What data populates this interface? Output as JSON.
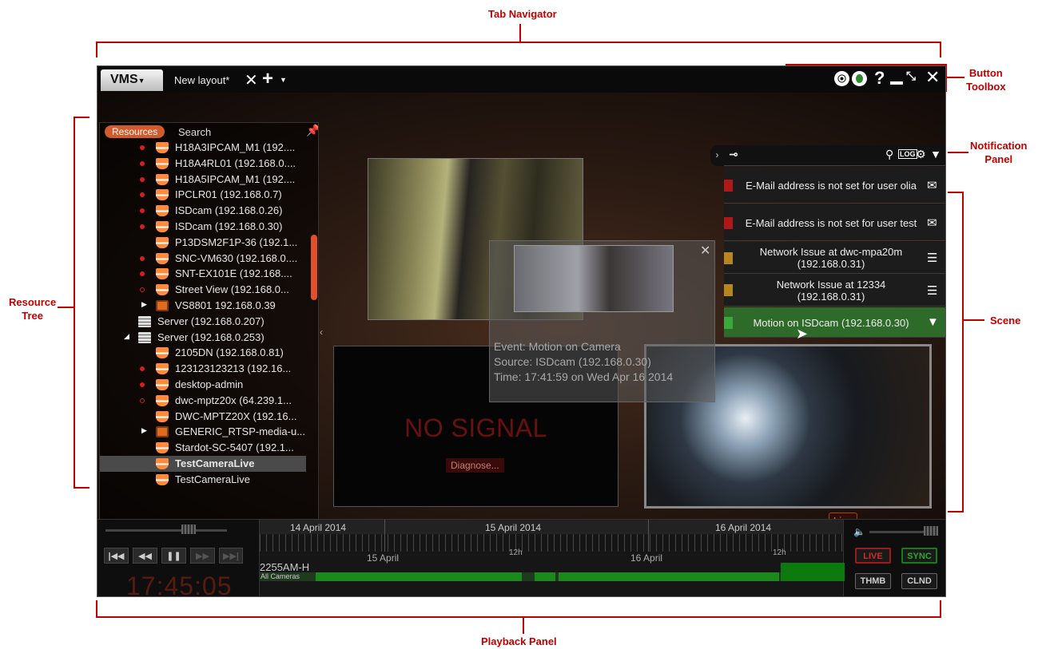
{
  "annotations": {
    "tab_navigator": "Tab Navigator",
    "button_toolbox": "Button\nToolbox",
    "notification_panel": "Notification\nPanel",
    "resource_tree": "Resource\nTree",
    "scene": "Scene",
    "playback_panel": "Playback Panel"
  },
  "titlebar": {
    "vms_label": "VMS",
    "layout_tab": "New layout*",
    "help": "?"
  },
  "resources": {
    "tab_resources": "Resources",
    "tab_search": "Search",
    "items": [
      {
        "label": "H18A3IPCAM_M1 (192....",
        "type": "cam",
        "rec": "on",
        "indent": 70
      },
      {
        "label": "H18A4RL01 (192.168.0....",
        "type": "cam",
        "rec": "on",
        "indent": 70
      },
      {
        "label": "H18A5IPCAM_M1 (192....",
        "type": "cam",
        "rec": "on",
        "indent": 70
      },
      {
        "label": "IPCLR01 (192.168.0.7)",
        "type": "cam",
        "rec": "on",
        "indent": 70
      },
      {
        "label": "ISDcam (192.168.0.26)",
        "type": "cam",
        "rec": "on",
        "indent": 70
      },
      {
        "label": "ISDcam (192.168.0.30)",
        "type": "cam",
        "rec": "on",
        "indent": 70
      },
      {
        "label": "P13DSM2F1P-36 (192.1...",
        "type": "cam",
        "rec": "none",
        "indent": 70
      },
      {
        "label": "SNC-VM630 (192.168.0....",
        "type": "cam",
        "rec": "on",
        "indent": 70
      },
      {
        "label": "SNT-EX101E (192.168....",
        "type": "cam",
        "rec": "on",
        "indent": 70
      },
      {
        "label": "Street View (192.168.0...",
        "type": "cam",
        "rec": "off",
        "indent": 70
      },
      {
        "label": "VS8801 192.168.0.39",
        "type": "enc",
        "rec": "expand",
        "indent": 70
      },
      {
        "label": "Server (192.168.0.207)",
        "type": "srv",
        "rec": "none",
        "indent": 48
      },
      {
        "label": "Server (192.168.0.253)",
        "type": "srv",
        "rec": "none",
        "indent": 48
      },
      {
        "label": "2105DN (192.168.0.81)",
        "type": "cam",
        "rec": "none",
        "indent": 70
      },
      {
        "label": "123123123213 (192.16...",
        "type": "cam",
        "rec": "on",
        "indent": 70
      },
      {
        "label": "desktop-admin",
        "type": "cam",
        "rec": "on",
        "indent": 70
      },
      {
        "label": "dwc-mptz20x (64.239.1...",
        "type": "cam",
        "rec": "off",
        "indent": 70
      },
      {
        "label": "DWC-MPTZ20X (192.16...",
        "type": "cam",
        "rec": "none",
        "indent": 70
      },
      {
        "label": "GENERIC_RTSP-media-u...",
        "type": "enc",
        "rec": "expand",
        "indent": 70
      },
      {
        "label": "Stardot-SC-5407 (192.1...",
        "type": "cam",
        "rec": "none",
        "indent": 70
      },
      {
        "label": "TestCameraLive",
        "type": "cam",
        "rec": "none",
        "indent": 70,
        "selected": true
      },
      {
        "label": "TestCameraLive",
        "type": "cam",
        "rec": "none",
        "indent": 70
      }
    ]
  },
  "scene": {
    "no_signal": "NO SIGNAL",
    "diagnose": "Diagnose...",
    "overlay_event": "Event: Motion on Camera",
    "overlay_source": "Source: ISDcam (192.168.0.30)",
    "overlay_time": "Time: 17:41:59 on Wed Apr 16 2014"
  },
  "notifications": {
    "items": [
      {
        "text": "E-Mail address is not set for user olia",
        "color": "#b01818",
        "icon": "mail-icon",
        "glyph": "✉"
      },
      {
        "text": "E-Mail address is not set for user test",
        "color": "#b01818",
        "icon": "mail-icon",
        "glyph": "✉"
      },
      {
        "text": "Network Issue at dwc-mpa20m\n(192.168.0.31)",
        "color": "#b8861e",
        "icon": "list-icon",
        "glyph": "☰"
      },
      {
        "text": "Network Issue at 12334\n(192.168.0.31)",
        "color": "#b8861e",
        "icon": "list-icon",
        "glyph": "☰"
      },
      {
        "text": "Motion on ISDcam (192.168.0.30)",
        "color": "#3aa83a",
        "icon": "camera-icon",
        "glyph": "▼",
        "green": true
      }
    ]
  },
  "playback": {
    "live_bubble": "Live",
    "clock": "17:45:05",
    "dates": [
      "14 April 2014",
      "15 April 2014",
      "16 April 2014"
    ],
    "sub_labels": [
      "15 April",
      "12h",
      "16 April",
      "12h"
    ],
    "timeline_label": "2255AM-H",
    "all_cameras": "All Cameras",
    "live_btn": "LIVE",
    "sync_btn": "SYNC",
    "thmb_btn": "THMB",
    "clnd_btn": "CLND"
  }
}
